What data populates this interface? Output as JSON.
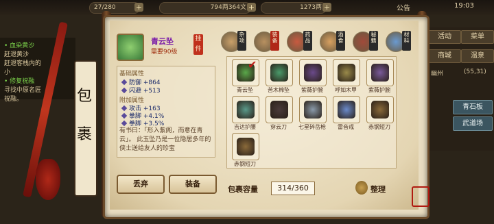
{
  "topbar": {
    "stamina": "27/280",
    "currency1": "794两364文",
    "currency2": "1273两",
    "notice": "公告",
    "time": "19:03"
  },
  "quest": {
    "lines": [
      {
        "text": "• 血染黄沙",
        "green": true
      },
      {
        "text": "赶退黄沙",
        "green": false
      },
      {
        "text": "赶退客栈内的",
        "green": false
      },
      {
        "text": "小",
        "green": false
      },
      {
        "text": "• 修复祝融",
        "green": true
      },
      {
        "text": "寻找中原名匠",
        "green": false
      },
      {
        "text": "祝融。",
        "green": false
      }
    ]
  },
  "right_nav": {
    "buttons": [
      "活动",
      "菜单",
      "商城",
      "温泉"
    ],
    "location": "幽州",
    "coords": "(55,31)",
    "skills": [
      "青石板",
      "武道场"
    ]
  },
  "inventory": {
    "title_chars": [
      "包",
      "裹"
    ],
    "selected": {
      "name": "青云坠",
      "requirement": "需要90级",
      "badge": "挂件",
      "base_label": "基础属性",
      "base_stats": [
        "防御 +864",
        "闪避 +513"
      ],
      "extra_label": "附加属性",
      "extra_stats": [
        "攻击 +163",
        "拳脚 +4.1%",
        "拳脚 +3.5%"
      ],
      "description": "有书曰：「形入紫阁，而意在青云」。 此玉坠乃是一位隐居多年的侠士送给友人的珍宝"
    },
    "drop_button": "丢弃",
    "equip_button": "装备",
    "categories": [
      {
        "label": "杂项",
        "active": false,
        "color": "#c9a06a"
      },
      {
        "label": "装备",
        "active": true,
        "color": "#b89060"
      },
      {
        "label": "药品",
        "active": false,
        "color": "#c85a40"
      },
      {
        "label": "酒食",
        "active": false,
        "color": "#d8a060"
      },
      {
        "label": "秘籍",
        "active": false,
        "color": "#a04a3a"
      },
      {
        "label": "材料",
        "active": false,
        "color": "#6a9ad0"
      }
    ],
    "items": [
      {
        "name": "青云坠",
        "color": "#5aa84a",
        "checked": true
      },
      {
        "name": "苦木棉坠",
        "color": "#4a9a6a",
        "checked": false
      },
      {
        "name": "紫薇护腕",
        "color": "#6a4a8a",
        "checked": false
      },
      {
        "name": "呼如木甲",
        "color": "#9a8a4a",
        "checked": false
      },
      {
        "name": "紫薇护腕",
        "color": "#7a5a9a",
        "checked": false
      },
      {
        "name": "吉达护腰",
        "color": "#5a9a8a",
        "checked": false
      },
      {
        "name": "穿云刀",
        "color": "#4a3a3a",
        "checked": false
      },
      {
        "name": "七星碎岳枪",
        "color": "#8a9aaa",
        "checked": false
      },
      {
        "name": "雷音戒",
        "color": "#6a8aca",
        "checked": false
      },
      {
        "name": "赤钢短刀",
        "color": "#8a6a3a",
        "checked": false
      },
      {
        "name": "赤钢短刀",
        "color": "#8a6a3a",
        "checked": false
      }
    ],
    "capacity_label": "包裹容量",
    "capacity_value": "314/360",
    "sort_button": "整理"
  }
}
